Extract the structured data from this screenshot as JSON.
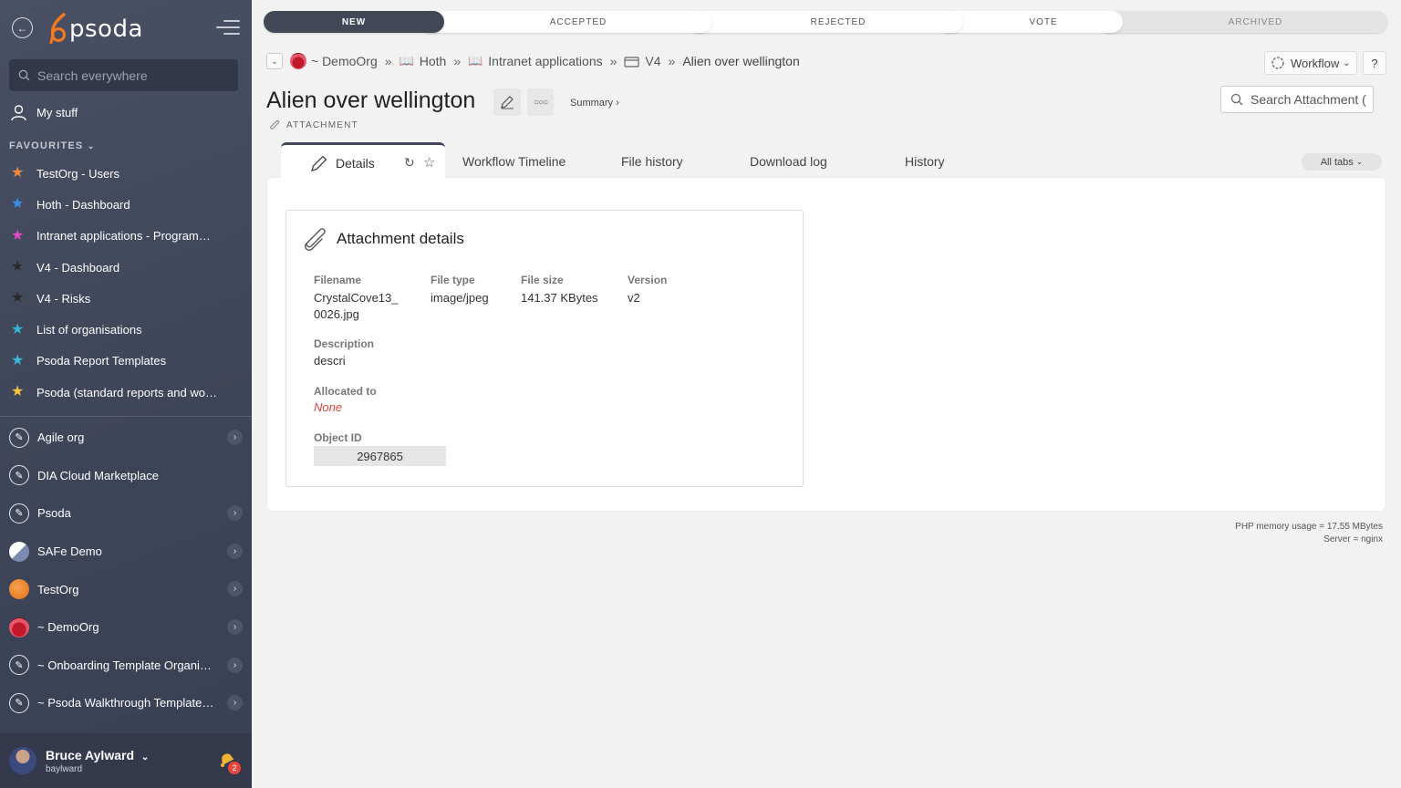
{
  "sidebar": {
    "search_placeholder": "Search everywhere",
    "my_stuff": "My stuff",
    "favourites_header": "FAVOURITES",
    "favourites": [
      {
        "label": "TestOrg - Users",
        "color": "#f08a3a"
      },
      {
        "label": "Hoth - Dashboard",
        "color": "#3b8de8"
      },
      {
        "label": "Intranet applications - Programme...",
        "color": "#e04cc8"
      },
      {
        "label": "V4 - Dashboard",
        "color": "#2a2a2a"
      },
      {
        "label": "V4 - Risks",
        "color": "#2a2a2a"
      },
      {
        "label": "List of organisations",
        "color": "#2fb6d8"
      },
      {
        "label": "Psoda Report Templates",
        "color": "#3bb7d9"
      },
      {
        "label": "Psoda (standard reports and work...",
        "color": "#f2c23a"
      }
    ],
    "orgs": [
      {
        "label": "Agile org",
        "icon": "pen-icon",
        "chevron": true
      },
      {
        "label": "DIA Cloud Marketplace",
        "icon": "pen-icon",
        "chevron": false
      },
      {
        "label": "Psoda",
        "icon": "pen-icon",
        "chevron": true
      },
      {
        "label": "SAFe Demo",
        "icon": "safe-logo",
        "chevron": true
      },
      {
        "label": "TestOrg",
        "icon": "orange-circle",
        "chevron": true
      },
      {
        "label": "~ DemoOrg",
        "icon": "demoorg-logo",
        "chevron": true
      },
      {
        "label": "~ Onboarding Template Organisa...",
        "icon": "pen-icon",
        "chevron": true
      },
      {
        "label": "~ Psoda Walkthrough Template P...",
        "icon": "pen-icon",
        "chevron": true
      }
    ],
    "user": {
      "name": "Bruce Aylward",
      "handle": "baylward",
      "notifications": "2"
    }
  },
  "workflow": {
    "steps": [
      "NEW",
      "ACCEPTED",
      "REJECTED",
      "VOTE",
      "ARCHIVED"
    ],
    "active": "NEW"
  },
  "breadcrumb": {
    "items": [
      "~ DemoOrg",
      "Hoth",
      "Intranet applications",
      "V4"
    ],
    "current": "Alien over wellington"
  },
  "header": {
    "workflow_button": "Workflow",
    "help": "?",
    "title": "Alien over wellington",
    "summary_link": "Summary ›",
    "object_type": "ATTACHMENT",
    "search_placeholder": "Search Attachment ("
  },
  "tabs": {
    "active": "Details",
    "others": [
      "Workflow Timeline",
      "File history",
      "Download log",
      "History"
    ],
    "all_tabs": "All tabs"
  },
  "details": {
    "title": "Attachment details",
    "filename_label": "Filename",
    "filename_line1": "CrystalCove13_",
    "filename_line2": "0026.jpg",
    "filetype_label": "File type",
    "filetype": "image/jpeg",
    "filesize_label": "File size",
    "filesize": "141.37 KBytes",
    "version_label": "Version",
    "version": "v2",
    "description_label": "Description",
    "description": "descri",
    "allocated_label": "Allocated to",
    "allocated": "None",
    "objectid_label": "Object ID",
    "objectid": "2967865"
  },
  "footer": {
    "memory": "PHP memory usage = 17.55 MBytes",
    "server": "Server = nginx"
  },
  "colors": {
    "sidebar_bg": "#444a5e",
    "accent_dark": "#424858",
    "logo_orange": "#f47a1f",
    "none_red": "#d9453b"
  }
}
